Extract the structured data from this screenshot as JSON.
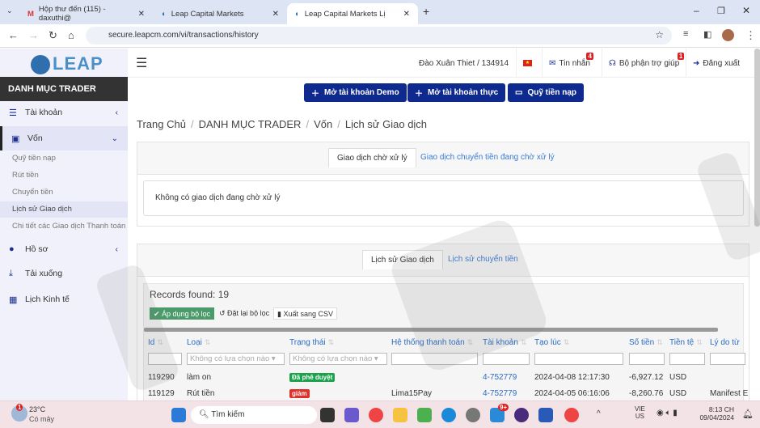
{
  "browser": {
    "tabs": [
      {
        "label": "Hộp thư đến (115) - daxuthi@"
      },
      {
        "label": "Leap Capital Markets"
      },
      {
        "label": "Leap Capital Markets Lịch sử G"
      }
    ],
    "url": "secure.leapcm.com/vi/transactions/history"
  },
  "logo": "LEAP",
  "sidebar": {
    "title": "DANH MỤC TRADER",
    "items": [
      {
        "label": "Tài khoản"
      },
      {
        "label": "Vốn"
      },
      {
        "label": "Hồ sơ"
      },
      {
        "label": "Tải xuống"
      },
      {
        "label": "Lịch Kinh tế"
      }
    ],
    "sub": [
      "Quỹ tiền nạp",
      "Rút tiền",
      "Chuyển tiền",
      "Lịch sử Giao dịch",
      "Chi tiết các Giao dịch Thanh toán"
    ]
  },
  "topbar": {
    "user": "Đào Xuân Thiet / 134914",
    "messages": "Tin nhắn",
    "messages_badge": "4",
    "support": "Bộ phận trợ giúp",
    "support_badge": "1",
    "logout": "Đăng xuất"
  },
  "actions": {
    "demo": "Mở tài khoản Demo",
    "real": "Mở tài khoản thực",
    "fund": "Quỹ tiền nạp"
  },
  "breadcrumb": [
    "Trang Chủ",
    "DANH MỤC TRADER",
    "Vốn",
    "Lịch sử Giao dịch"
  ],
  "pending": {
    "tabs": [
      "Giao dịch chờ xử lý",
      "Giao dịch chuyển tiền đang chờ xử lý"
    ],
    "message": "Không có giao dịch đang chờ xử lý"
  },
  "history": {
    "tabs": [
      "Lịch sử Giao dịch",
      "Lịch sử chuyển tiền"
    ],
    "records": "Records found: 19",
    "apply": "Áp dụng bộ lọc",
    "reset": "Đặt lại bộ lọc",
    "export": "Xuất sang CSV",
    "columns": [
      "Id",
      "Loại",
      "Trạng thái",
      "Hệ thống thanh toán",
      "Tài khoản",
      "Tạo lúc",
      "Số tiền",
      "Tiền tệ",
      "Lý do từ"
    ],
    "select_placeholder": "Không có lựa chọn nào",
    "rows": [
      {
        "id": "119290",
        "type": "làm on",
        "status": "Đã phê duyệt",
        "status_color": "#1aa34a",
        "system": "",
        "account": "4-752779",
        "created": "2024-04-08 12:17:30",
        "amount": "-6,927.12",
        "currency": "USD",
        "reason": ""
      },
      {
        "id": "119129",
        "type": "Rút tiền",
        "status": "giảm",
        "status_color": "#e0302a",
        "system": "Lima15Pay",
        "account": "4-752779",
        "created": "2024-04-05 06:16:06",
        "amount": "-8,260.76",
        "currency": "USD",
        "reason": "Manifest E"
      }
    ]
  },
  "taskbar": {
    "temp": "23°C",
    "weather": "Có mây",
    "weather_badge": "1",
    "search": "Tìm kiếm",
    "lang1": "VIE",
    "lang2": "US",
    "time": "8:13 CH",
    "date": "09/04/2024",
    "notif": "9+"
  }
}
